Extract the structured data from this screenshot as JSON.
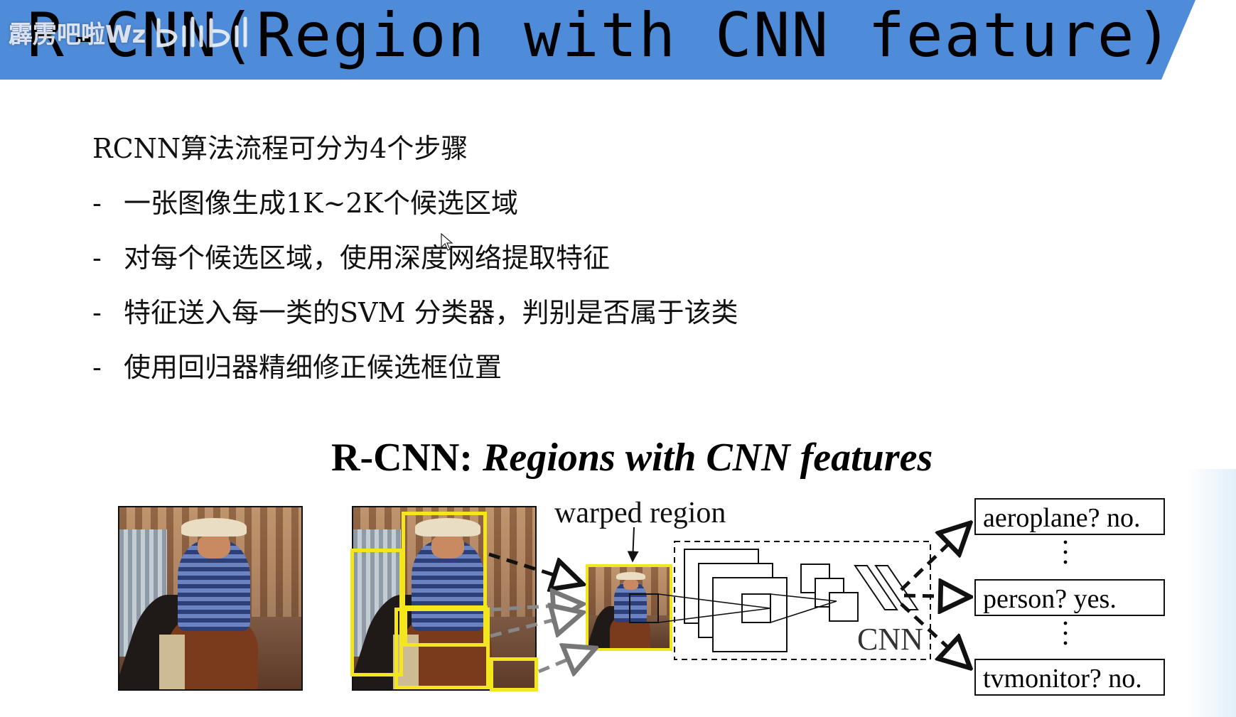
{
  "slide": {
    "title": "R-CNN(Region with CNN feature)",
    "watermark": {
      "text": "霹雳吧啦Wz",
      "logo_icon": "bilibili-logo-icon"
    },
    "colors": {
      "title_band": "#4e8bd8",
      "box_highlight": "#f3e61c"
    }
  },
  "steps": {
    "intro": "RCNN算法流程可分为4个步骤",
    "dash": "-",
    "items": [
      "一张图像生成1K~2K个候选区域",
      "对每个候选区域，使用深度网络提取特征",
      "特征送入每一类的SVM 分类器，判别是否属于该类",
      "使用回归器精细修正候选框位置"
    ]
  },
  "diagram": {
    "title_prefix": "R-CNN:",
    "title_italic": "Regions with CNN features",
    "warped_label": "warped region",
    "cnn_label": "CNN",
    "results": [
      "aeroplane? no.",
      "person? yes.",
      "tvmonitor? no."
    ],
    "ellipsis": "⋮"
  }
}
